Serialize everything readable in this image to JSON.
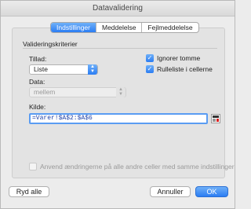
{
  "window": {
    "title": "Datavalidering"
  },
  "tabs": [
    {
      "label": "Indstillinger",
      "active": true
    },
    {
      "label": "Meddelelse",
      "active": false
    },
    {
      "label": "Fejlmeddelelse",
      "active": false
    }
  ],
  "criteria": {
    "group_label": "Valideringskriterier",
    "allow_label": "Tillad:",
    "allow_value": "Liste",
    "data_label": "Data:",
    "data_value": "mellem",
    "ignore_blank_label": "Ignorer tomme",
    "ignore_blank_checked": true,
    "in_cell_dropdown_label": "Rulleliste i cellerne",
    "in_cell_dropdown_checked": true,
    "source_label": "Kilde:",
    "source_value": "=Varer!$A$2:$A$6"
  },
  "apply_all": {
    "label": "Anvend ændringerne på alle andre celler med samme indstillinger",
    "checked": false,
    "enabled": false
  },
  "buttons": {
    "clear_all": "Ryd alle",
    "cancel": "Annuller",
    "ok": "OK"
  },
  "colors": {
    "accent": "#2b7df3"
  }
}
